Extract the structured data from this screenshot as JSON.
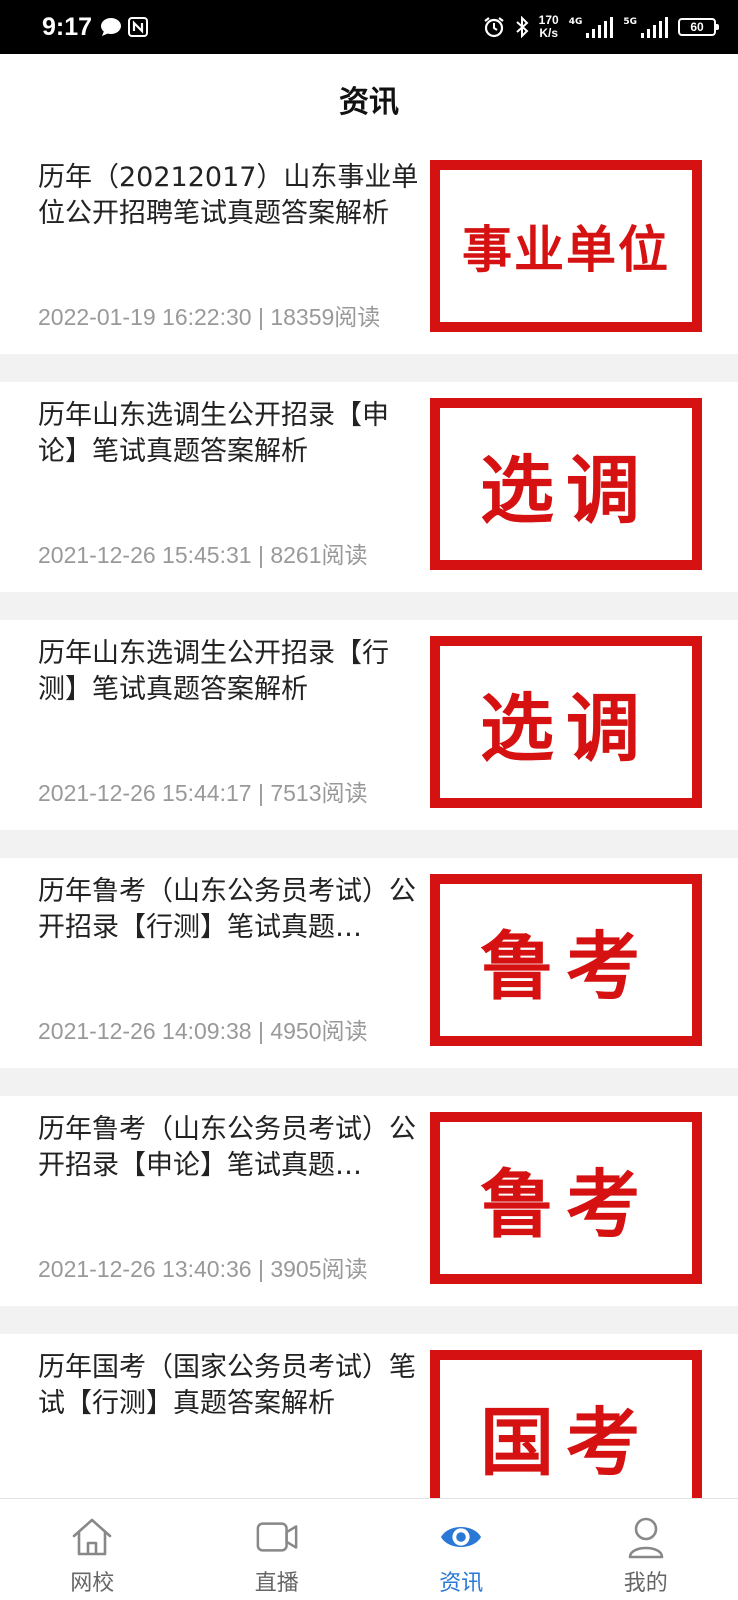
{
  "status_bar": {
    "time": "9:17",
    "net_speed_value": "170",
    "net_speed_unit": "K/s",
    "signal1_label": "4G",
    "signal2_label": "5G",
    "battery": "60"
  },
  "header": {
    "title": "资讯"
  },
  "articles": [
    {
      "title": "历年（20212017）山东事业单位公开招聘笔试真题答案解析",
      "meta": "2022-01-19 16:22:30 | 18359阅读",
      "thumb_text": "事业单位"
    },
    {
      "title": "历年山东选调生公开招录【申论】笔试真题答案解析",
      "meta": "2021-12-26 15:45:31 | 8261阅读",
      "thumb_text": "选调"
    },
    {
      "title": "历年山东选调生公开招录【行测】笔试真题答案解析",
      "meta": "2021-12-26 15:44:17 | 7513阅读",
      "thumb_text": "选调"
    },
    {
      "title": "历年鲁考（山东公务员考试）公开招录【行测】笔试真题…",
      "meta": "2021-12-26 14:09:38 | 4950阅读",
      "thumb_text": "鲁考"
    },
    {
      "title": "历年鲁考（山东公务员考试）公开招录【申论】笔试真题…",
      "meta": "2021-12-26 13:40:36 | 3905阅读",
      "thumb_text": "鲁考"
    },
    {
      "title": "历年国考（国家公务员考试）笔试【行测】真题答案解析",
      "meta": "",
      "thumb_text": "国考"
    }
  ],
  "tabs": [
    {
      "label": "网校",
      "icon": "home-icon"
    },
    {
      "label": "直播",
      "icon": "video-icon"
    },
    {
      "label": "资讯",
      "icon": "eye-icon",
      "active": true
    },
    {
      "label": "我的",
      "icon": "user-icon"
    }
  ],
  "colors": {
    "accent": "#2a78d6",
    "thumb_red": "#d51111"
  }
}
